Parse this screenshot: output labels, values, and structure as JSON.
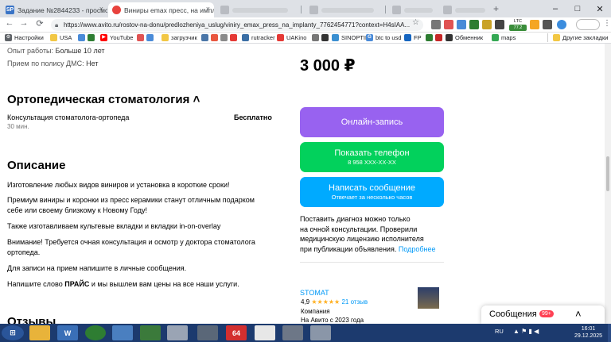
{
  "browser": {
    "tabs": [
      {
        "favicon": "SP",
        "title": "Задание №2844233 - просмотр з"
      },
      {
        "favicon": "avito",
        "title": "Виниры emax пресс, на имплант"
      },
      {
        "favicon": "blurred",
        "title": ""
      },
      {
        "favicon": "blurred",
        "title": ""
      },
      {
        "favicon": "blurred",
        "title": ""
      },
      {
        "favicon": "blurred",
        "title": ""
      }
    ],
    "tab_close": "×",
    "new_tab": "+",
    "url": "https://www.avito.ru/rostov-na-donu/predlozheniya_uslug/viniry_emax_press_na_implanty_7762454771?context=H4sIAA...",
    "nav": {
      "back": "←",
      "forward": "→",
      "reload": "⟳"
    },
    "ext_badges": {
      "ltc": "LTC",
      "ltc_val": "77.2"
    },
    "bookmarks": [
      "Настройки",
      "USA",
      "YouTube",
      "загрузчик",
      "rutracker",
      "UAKino",
      "SINOPTIK",
      "btc to usd",
      "FP",
      "Обменник",
      "maps"
    ],
    "other_bookmarks": "Другие закладки",
    "window": {
      "minimize": "–",
      "maximize": "□",
      "close": "✕"
    }
  },
  "left": {
    "experience_label": "Опыт работы:",
    "experience_value": "Больше 10 лет",
    "dms_label": "Прием по полису ДМС:",
    "dms_value": "Нет",
    "ortho_title": "Ортопедическая стоматология",
    "ortho_chevron": "˄",
    "service_name": "Консультация стоматолога-ортопеда",
    "service_price": "Бесплатно",
    "service_duration": "30 мин.",
    "desc_title": "Описание",
    "desc_p1": "Изготовление любых видов виниров и установка в короткие сроки!",
    "desc_p2a": "Премиум виниры и коронки из пресс керамики станут отличным подарком",
    "desc_p2b": "себе или своему близкому к Новому Году!",
    "desc_p3": "Также изготавливаем культевые вкладки и вкладки in-on-overlay",
    "desc_p4a": "Внимание! Требуется очная консультация и осмотр у доктора стоматолога",
    "desc_p4b": "ортопеда.",
    "desc_p5": "Для записи на прием напишите в личные сообщения.",
    "desc_p6_pre": "Напишите слово ",
    "desc_p6_bold": "ПРАЙС",
    "desc_p6_post": " и мы вышлем вам цены на все наши услуги.",
    "reviews_title": "Отзывы"
  },
  "right": {
    "price": "3 000 ₽",
    "btn_online": "Онлайн-запись",
    "btn_phone": "Показать телефон",
    "btn_phone_sub": "8 958 XXX-XX-XX",
    "btn_message": "Написать сообщение",
    "btn_message_sub": "Отвечает за несколько часов",
    "notice_l1": "Поставить диагноз можно только",
    "notice_l2": "на очной консультации. Проверили",
    "notice_l3": "медицинскую лицензию исполнителя",
    "notice_l4": "при публикации объявления.",
    "notice_link": "Подробнее",
    "seller_name": "STOMAT",
    "seller_rating": "4,9",
    "seller_stars": "★★★★★",
    "seller_reviews": "21 отзыв",
    "seller_type": "Компания",
    "seller_since": "На Авито с 2023 года"
  },
  "messages": {
    "label": "Сообщения",
    "badge": "99+",
    "chevron": "˄"
  },
  "taskbar": {
    "lang": "RU",
    "time": "16:01",
    "date": "29.12.2025",
    "app_64": "64"
  },
  "colors": {
    "online_btn": "#9862f0",
    "phone_btn": "#02d15c",
    "message_btn": "#00aaff",
    "link": "#0099f7",
    "taskbar": "#1c3a6e"
  }
}
